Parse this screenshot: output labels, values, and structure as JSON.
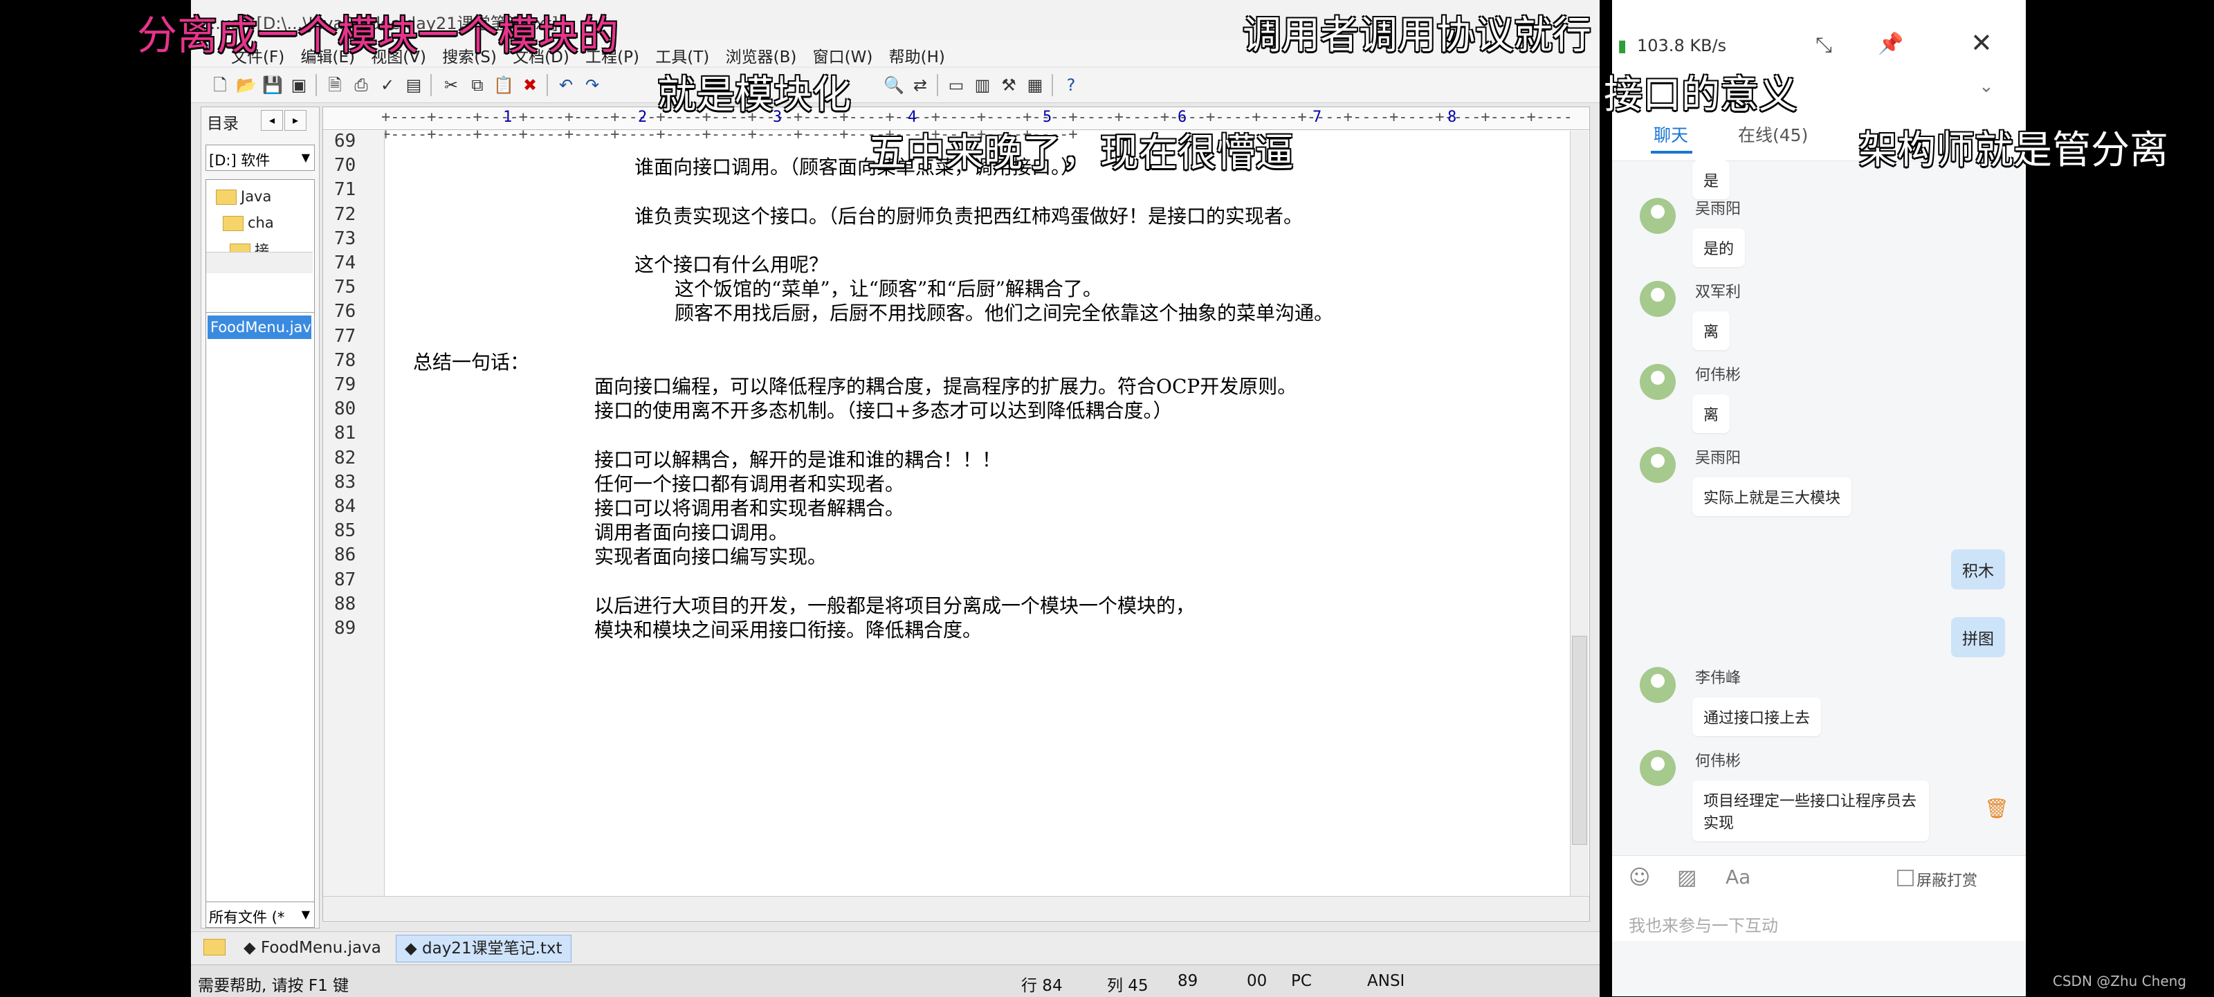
{
  "editor": {
    "title": "...us - [D:\\...\\JavaSE\\doc\\day21课堂笔记.txt]",
    "menu": [
      "文件(F)",
      "编辑(E)",
      "视图(V)",
      "搜索(S)",
      "文档(D)",
      "工程(P)",
      "工具(T)",
      "浏览器(B)",
      "窗口(W)",
      "帮助(H)"
    ],
    "toolbar_icons": [
      "new-file-icon",
      "open-icon",
      "save-icon",
      "save-all-icon",
      "print-preview-icon",
      "print-icon",
      "spellcheck-icon",
      "cut-icon",
      "copy-icon",
      "paste-icon",
      "delete-icon",
      "undo-icon",
      "redo-icon",
      "find-icon",
      "replace-icon",
      "help-icon"
    ],
    "left_panel": {
      "title": "目录",
      "drive": "[D:] 软件",
      "tree": [
        "Java",
        "cha",
        "接"
      ],
      "file": "FoodMenu.java",
      "filter": "所有文件 (*"
    },
    "ruler": [
      "1",
      "2",
      "3",
      "4",
      "5",
      "6",
      "7",
      "8"
    ],
    "lines": [
      {
        "n": "69",
        "indent": 0,
        "text": ""
      },
      {
        "n": "70",
        "indent": 2,
        "text": "谁面向接口调用。（顾客面向菜单点菜，调用接口。）"
      },
      {
        "n": "71",
        "indent": 0,
        "text": ""
      },
      {
        "n": "72",
        "indent": 2,
        "text": "谁负责实现这个接口。（后台的厨师负责把西红柿鸡蛋做好！是接口的实现者。"
      },
      {
        "n": "73",
        "indent": 0,
        "text": ""
      },
      {
        "n": "74",
        "indent": 2,
        "text": "这个接口有什么用呢？"
      },
      {
        "n": "75",
        "indent": 3,
        "text": "这个饭馆的“菜单”，让“顾客”和“后厨”解耦合了。"
      },
      {
        "n": "76",
        "indent": 3,
        "text": "顾客不用找后厨，后厨不用找顾客。他们之间完全依靠这个抽象的菜单沟通。"
      },
      {
        "n": "77",
        "indent": 0,
        "text": ""
      },
      {
        "n": "78",
        "indent": 0,
        "text": "总结一句话："
      },
      {
        "n": "79",
        "indent": 1,
        "text": "面向接口编程，可以降低程序的耦合度，提高程序的扩展力。符合OCP开发原则。"
      },
      {
        "n": "80",
        "indent": 1,
        "text": "接口的使用离不开多态机制。（接口+多态才可以达到降低耦合度。）"
      },
      {
        "n": "81",
        "indent": 0,
        "text": ""
      },
      {
        "n": "82",
        "indent": 1,
        "text": "接口可以解耦合，解开的是谁和谁的耦合！！！"
      },
      {
        "n": "83",
        "indent": 1,
        "text": "任何一个接口都有调用者和实现者。"
      },
      {
        "n": "84",
        "indent": 1,
        "text": "接口可以将调用者和实现者解耦合。"
      },
      {
        "n": "85",
        "indent": 1,
        "text": "调用者面向接口调用。"
      },
      {
        "n": "86",
        "indent": 1,
        "text": "实现者面向接口编写实现。"
      },
      {
        "n": "87",
        "indent": 0,
        "text": ""
      },
      {
        "n": "88",
        "indent": 1,
        "text": "以后进行大项目的开发，一般都是将项目分离成一个模块一个模块的，"
      },
      {
        "n": "89",
        "indent": 1,
        "text": "模块和模块之间采用接口衔接。降低耦合度。"
      }
    ],
    "tabs": [
      "FoodMenu.java",
      "day21课堂笔记.txt"
    ],
    "status": {
      "help": "需要帮助, 请按 F1 键",
      "row": "行 84",
      "col": "列 45",
      "len": "89",
      "mode": "00",
      "eol": "PC",
      "enc": "ANSI"
    }
  },
  "chat": {
    "speed": "103.8 KB/s",
    "tabs": [
      "聊天",
      "在线(45)"
    ],
    "messages": [
      {
        "user": "",
        "text": "是"
      },
      {
        "user": "吴雨阳",
        "text": "是的"
      },
      {
        "user": "双军利",
        "text": "离"
      },
      {
        "user": "何伟彬",
        "text": "离"
      },
      {
        "user": "吴雨阳",
        "text": "实际上就是三大模块"
      },
      {
        "user": "李伟峰",
        "text": "通过接口接上去"
      },
      {
        "user": "何伟彬",
        "text": "项目经理定一些接口让程序员去实现"
      }
    ],
    "mine": [
      "积木",
      "拼图"
    ],
    "shield_label": "屏蔽打赏",
    "input_placeholder": "我也来参与一下互动"
  },
  "overlays": {
    "pink": "分离成一个模块一个模块的",
    "top_right": "调用者调用协议就行",
    "module": "就是模块化",
    "interface_meaning": "接口的意义",
    "late": "五中来晚了，现在很懵逼",
    "architect": "架构师就是管分离"
  },
  "watermark": "CSDN @Zhu Cheng",
  "colors": {
    "accent": "#1976d2",
    "selected_file": "#3a8be0",
    "overlay_pink": "#e6348c",
    "code_text": "#000000"
  }
}
